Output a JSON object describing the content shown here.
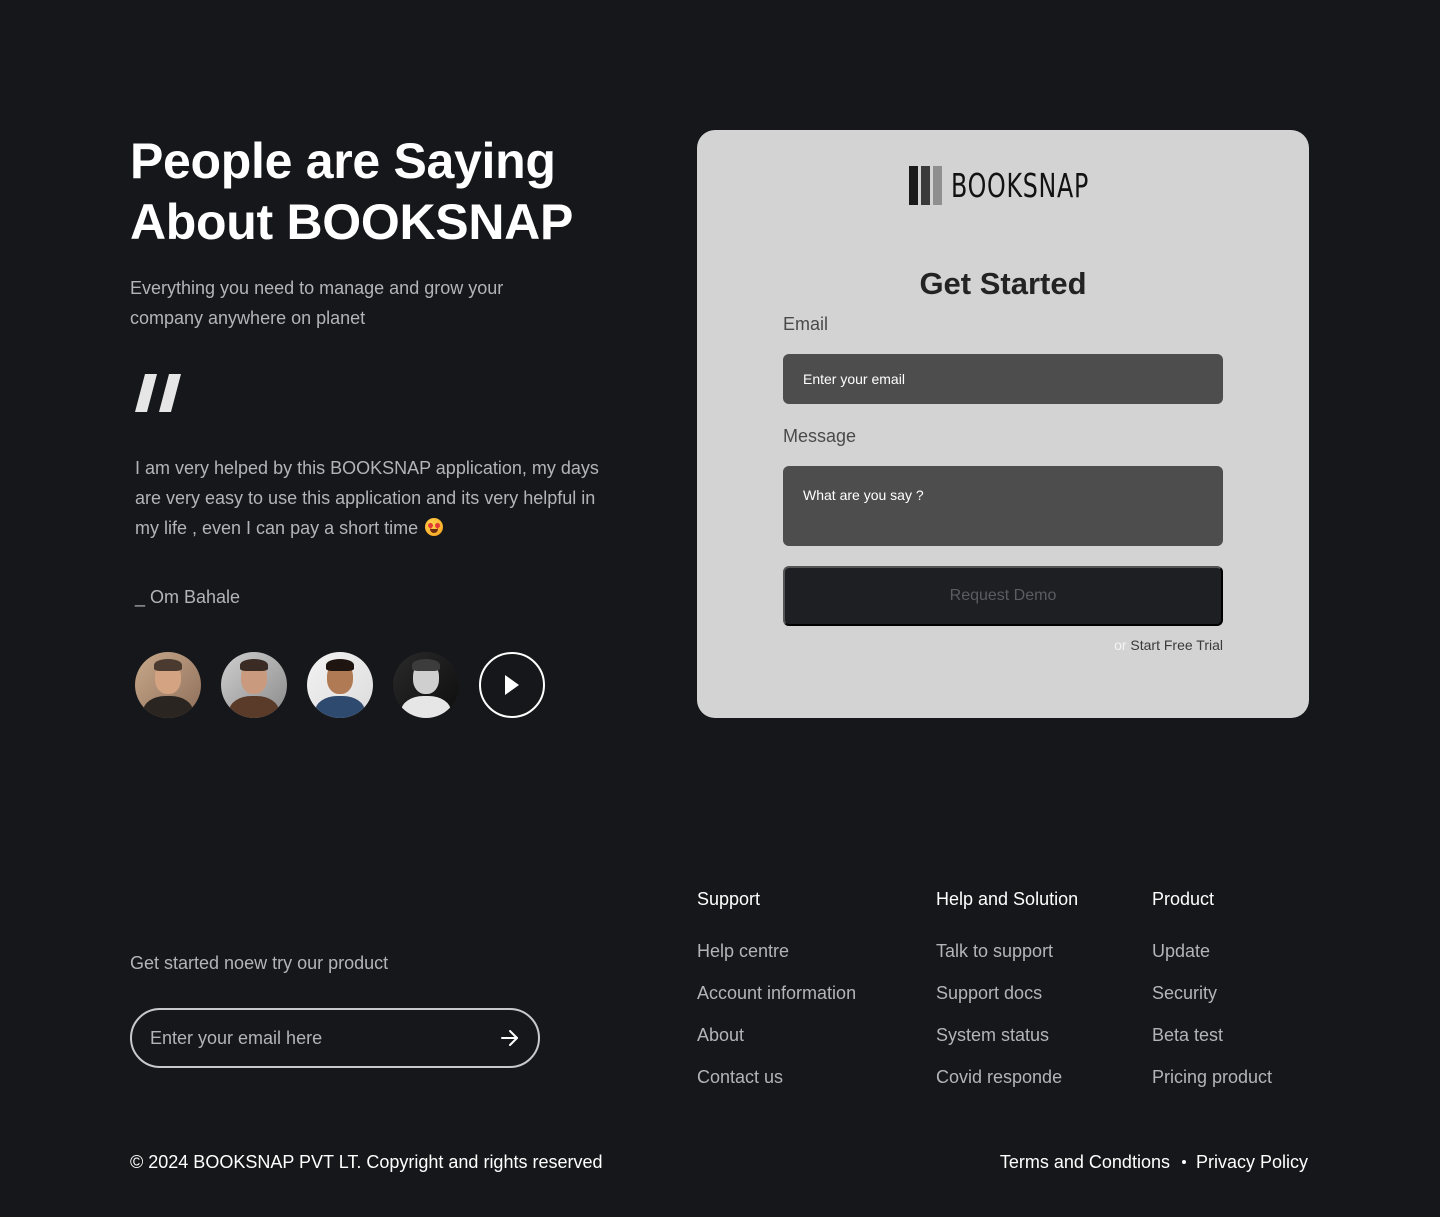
{
  "testimonial": {
    "heading": "People are Saying About BOOKSNAP",
    "subheading": "Everything you need to manage and grow your company anywhere on planet",
    "quote": "I am very helped by this BOOKSNAP application, my days are very easy to use this application and its very helpful in my life , even I can pay a short time",
    "quote_emoji_icon": "heart-eyes-emoji-icon",
    "author": "_ Om Bahale",
    "avatar_count": 4,
    "play_icon": "play-icon"
  },
  "form": {
    "brand": "BOOKSNAP",
    "brand_bar_colors": [
      "#1a1a1a",
      "#3a3a3a",
      "#8f8f8f"
    ],
    "title": "Get Started",
    "email_label": "Email",
    "email_placeholder": "Enter your email",
    "message_label": "Message",
    "message_placeholder": "What are you say ?",
    "submit_label": "Request Demo",
    "alt_prefix": "or",
    "alt_link": "Start Free Trial"
  },
  "footer": {
    "newsletter_text": "Get started noew try our product",
    "newsletter_placeholder": "Enter your email here",
    "newsletter_icon": "arrow-right-icon",
    "columns": [
      {
        "title": "Support",
        "links": [
          "Help centre",
          "Account information",
          "About",
          "Contact us"
        ]
      },
      {
        "title": "Help and Solution",
        "links": [
          "Talk to support",
          "Support docs",
          "System status",
          "Covid responde"
        ]
      },
      {
        "title": "Product",
        "links": [
          "Update",
          "Security",
          "Beta test",
          "Pricing product"
        ]
      }
    ],
    "copyright": "© 2024 BOOKSNAP PVT LT. Copyright and rights reserved",
    "terms": "Terms and Condtions",
    "privacy": "Privacy Policy"
  },
  "colors": {
    "background": "#16171a",
    "card": "#d3d3d3",
    "input": "#4d4d4d",
    "button": "#1e1f23",
    "muted_text": "#b4b4b8"
  }
}
